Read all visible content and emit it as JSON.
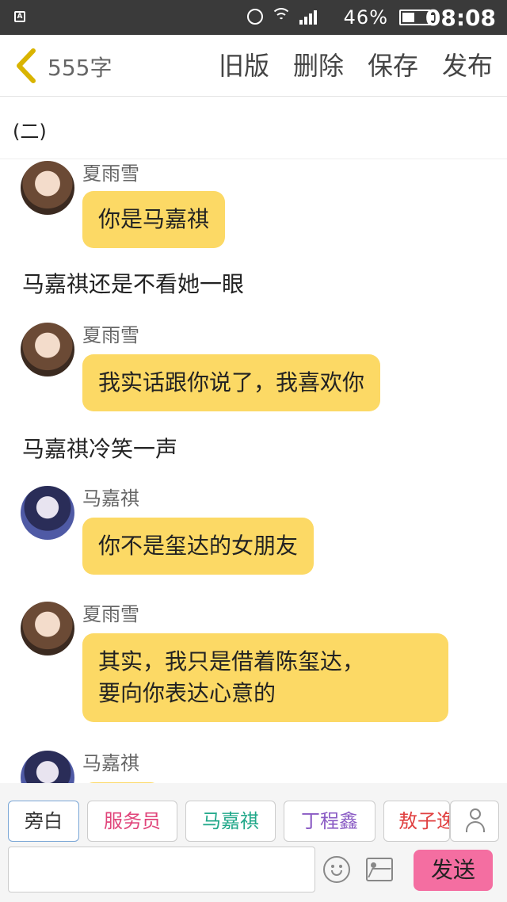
{
  "status": {
    "app_badge": "A",
    "battery_pct": "46%",
    "battery_level": 0.46,
    "time": "08:08"
  },
  "header": {
    "word_count": "555字",
    "actions": [
      "旧版",
      "删除",
      "保存",
      "发布"
    ]
  },
  "chapter": "(二)",
  "messages": [
    {
      "type": "chat",
      "speaker": "夏雨雪",
      "avatar": "girl",
      "lines": [
        "你是马嘉祺"
      ]
    },
    {
      "type": "narration",
      "text": "马嘉祺还是不看她一眼"
    },
    {
      "type": "chat",
      "speaker": "夏雨雪",
      "avatar": "girl",
      "lines": [
        "我实话跟你说了，我喜欢你"
      ]
    },
    {
      "type": "narration",
      "text": "马嘉祺冷笑一声"
    },
    {
      "type": "chat",
      "speaker": "马嘉祺",
      "avatar": "boy",
      "lines": [
        "你不是玺达的女朋友"
      ]
    },
    {
      "type": "chat",
      "speaker": "夏雨雪",
      "avatar": "girl",
      "lines": [
        "其实，我只是借着陈玺达，",
        "要向你表达心意的"
      ]
    },
    {
      "type": "chat",
      "speaker": "马嘉祺",
      "avatar": "boy",
      "lines": [
        ""
      ]
    }
  ],
  "roles": [
    {
      "label": "旁白",
      "color": "#333333"
    },
    {
      "label": "服务员",
      "color": "#e0447a"
    },
    {
      "label": "马嘉祺",
      "color": "#22a88a"
    },
    {
      "label": "丁程鑫",
      "color": "#8a5bc4"
    },
    {
      "label": "敖子逸",
      "color": "#e04040"
    }
  ],
  "composer": {
    "input_value": "",
    "send_label": "发送"
  },
  "icons": {
    "back": "chevron-left-icon",
    "add_role": "person-icon",
    "emoji": "smiley-icon",
    "image": "image-icon"
  },
  "colors": {
    "bubble": "#fcd965",
    "send": "#f46ea1",
    "back": "#d9b400"
  }
}
